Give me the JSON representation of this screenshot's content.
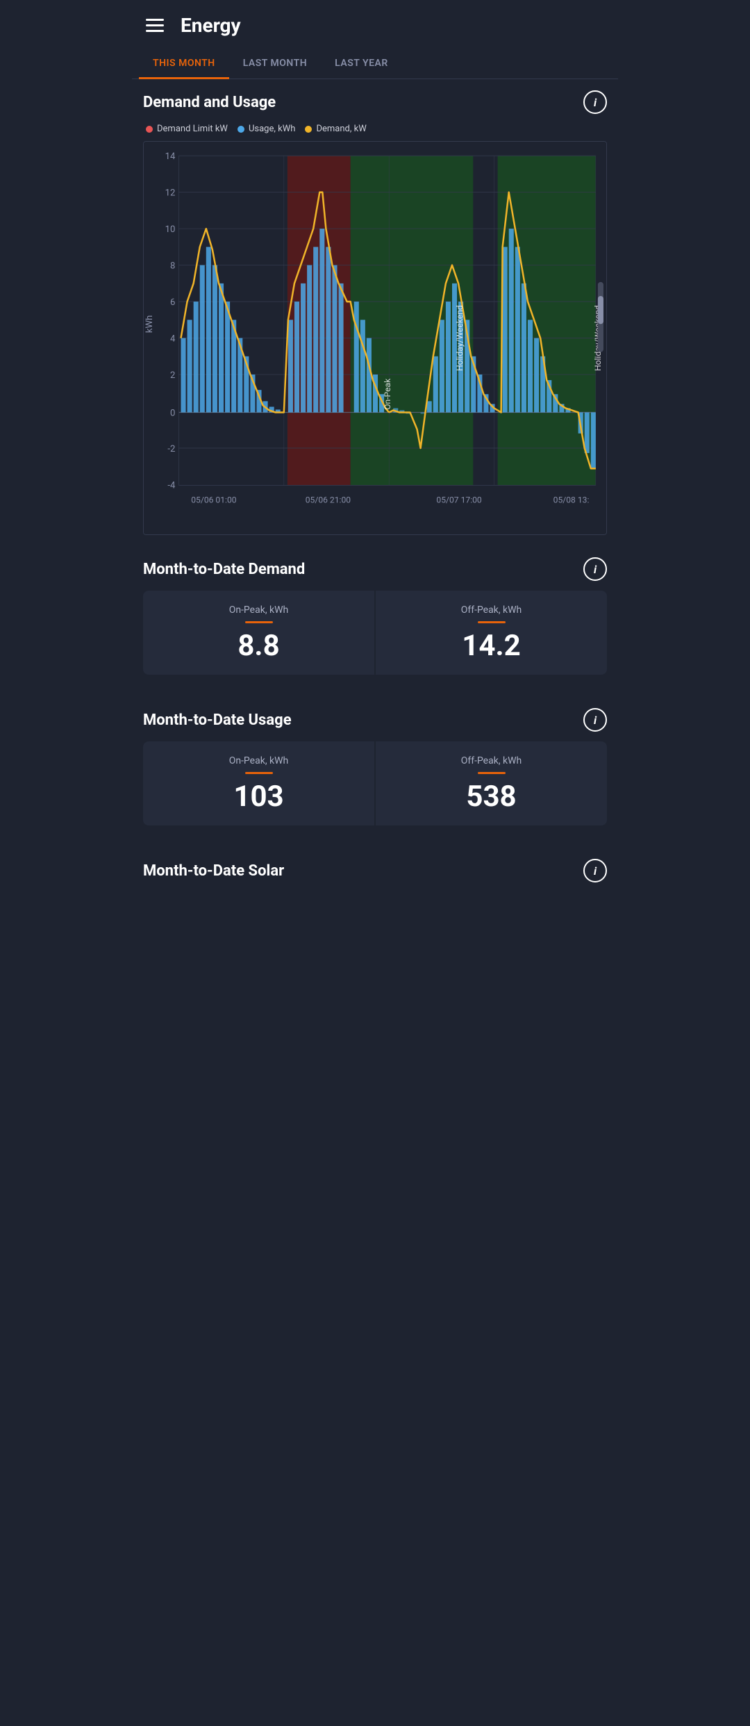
{
  "header": {
    "title": "Energy"
  },
  "tabs": [
    {
      "label": "THIS MONTH",
      "active": true
    },
    {
      "label": "LAST MONTH",
      "active": false
    },
    {
      "label": "LAST YEAR",
      "active": false
    }
  ],
  "demand_usage_section": {
    "title": "Demand and Usage",
    "info": "i",
    "legend": [
      {
        "label": "Demand Limit kW",
        "color": "#e85555",
        "id": "demand-limit"
      },
      {
        "label": "Usage, kWh",
        "color": "#4da8e8",
        "id": "usage"
      },
      {
        "label": "Demand, kW",
        "color": "#f0b429",
        "id": "demand"
      }
    ],
    "x_labels": [
      "05/06 01:00",
      "05/06 21:00",
      "05/07 17:00",
      "05/08 13:"
    ],
    "y_labels": [
      "14",
      "12",
      "10",
      "8",
      "6",
      "4",
      "2",
      "0",
      "-2",
      "-4"
    ],
    "y_axis_label": "kWh",
    "annotations": [
      "On-Peak",
      "Holiday/Weekend",
      "Holiday/Weekend"
    ]
  },
  "month_demand_section": {
    "title": "Month-to-Date Demand",
    "info": "i",
    "cards": [
      {
        "label": "On-Peak, kWh",
        "value": "8.8"
      },
      {
        "label": "Off-Peak, kWh",
        "value": "14.2"
      }
    ]
  },
  "month_usage_section": {
    "title": "Month-to-Date Usage",
    "info": "i",
    "cards": [
      {
        "label": "On-Peak, kWh",
        "value": "103"
      },
      {
        "label": "Off-Peak, kWh",
        "value": "538"
      }
    ]
  },
  "month_solar_section": {
    "title": "Month-to-Date Solar",
    "info": "i"
  }
}
